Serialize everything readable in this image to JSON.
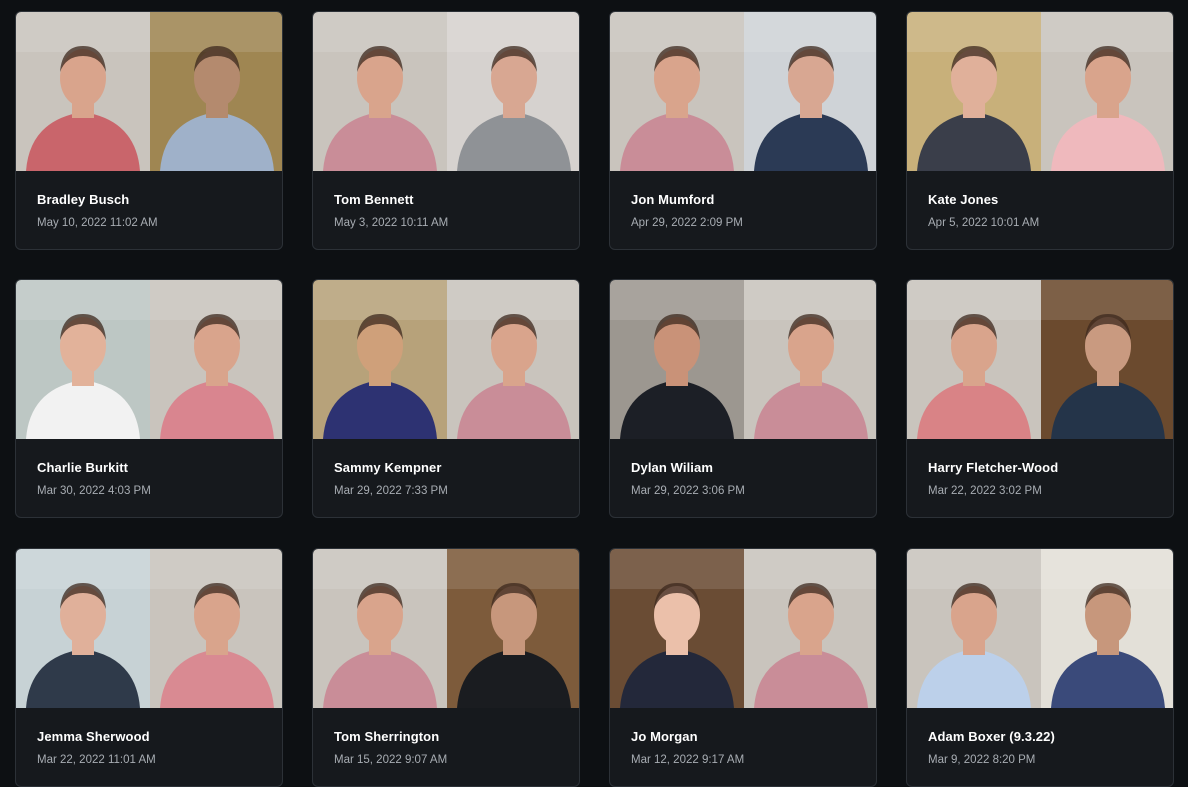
{
  "recordings": [
    {
      "name": "Bradley Busch",
      "date": "May 10, 2022 11:02 AM",
      "left_bg": "#c9c4bd",
      "left_shirt": "#c9656b",
      "left_skin": "#d9a48c",
      "right_bg": "#9f8652",
      "right_shirt": "#9fb1c9",
      "right_skin": "#b48a6e"
    },
    {
      "name": "Tom Bennett",
      "date": "May 3, 2022 10:11 AM",
      "left_bg": "#c9c4bd",
      "left_shirt": "#c98d98",
      "left_skin": "#d9a48c",
      "right_bg": "#d6d2cf",
      "right_shirt": "#8f9296",
      "right_skin": "#d8a792"
    },
    {
      "name": "Jon Mumford",
      "date": "Apr 29, 2022 2:09 PM",
      "left_bg": "#c9c4bd",
      "left_shirt": "#c98d98",
      "left_skin": "#d9a48c",
      "right_bg": "#cfd3d7",
      "right_shirt": "#2b3a55",
      "right_skin": "#d8a792"
    },
    {
      "name": "Kate Jones",
      "date": "Apr 5, 2022 10:01 AM",
      "left_bg": "#c8b07a",
      "left_shirt": "#3a3e4a",
      "left_skin": "#e0b09a",
      "right_bg": "#c9c4bd",
      "right_shirt": "#efb9bd",
      "right_skin": "#d9a48c"
    },
    {
      "name": "Charlie Burkitt",
      "date": "Mar 30, 2022 4:03 PM",
      "left_bg": "#bdc7c4",
      "left_shirt": "#f2f2f2",
      "left_skin": "#e2b29a",
      "right_bg": "#c9c4bd",
      "right_shirt": "#d9858f",
      "right_skin": "#d9a48c"
    },
    {
      "name": "Sammy Kempner",
      "date": "Mar 29, 2022 7:33 PM",
      "left_bg": "#b7a27a",
      "left_shirt": "#2d3272",
      "left_skin": "#cfa07a",
      "right_bg": "#c9c4bd",
      "right_shirt": "#c98d98",
      "right_skin": "#d9a48c"
    },
    {
      "name": "Dylan Wiliam",
      "date": "Mar 29, 2022 3:06 PM",
      "left_bg": "#9c9790",
      "left_shirt": "#1c1f26",
      "left_skin": "#c99278",
      "right_bg": "#c9c4bd",
      "right_shirt": "#c98d98",
      "right_skin": "#d9a48c"
    },
    {
      "name": "Harry Fletcher-Wood",
      "date": "Mar 22, 2022 3:02 PM",
      "left_bg": "#c9c4bd",
      "left_shirt": "#d98386",
      "left_skin": "#d9a48c",
      "right_bg": "#6b4a2e",
      "right_shirt": "#243449",
      "right_skin": "#c99a80"
    },
    {
      "name": "Jemma Sherwood",
      "date": "Mar 22, 2022 11:01 AM",
      "left_bg": "#c7d2d5",
      "left_shirt": "#2f3a4a",
      "left_skin": "#e0b09a",
      "right_bg": "#c9c4bd",
      "right_shirt": "#d98a92",
      "right_skin": "#d9a48c"
    },
    {
      "name": "Tom Sherrington",
      "date": "Mar 15, 2022 9:07 AM",
      "left_bg": "#c9c4bd",
      "left_shirt": "#c98d98",
      "left_skin": "#d9a48c",
      "right_bg": "#7d5b3b",
      "right_shirt": "#1a1c20",
      "right_skin": "#c7977c"
    },
    {
      "name": "Jo Morgan",
      "date": "Mar 12, 2022 9:17 AM",
      "left_bg": "#6a4c34",
      "left_shirt": "#23283a",
      "left_skin": "#ebc0aa",
      "right_bg": "#c9c4bd",
      "right_shirt": "#c98d98",
      "right_skin": "#d9a48c"
    },
    {
      "name": "Adam Boxer (9.3.22)",
      "date": "Mar 9, 2022 8:20 PM",
      "left_bg": "#c9c4bd",
      "left_shirt": "#bcd0ea",
      "left_skin": "#d9a48c",
      "right_bg": "#e3e0d8",
      "right_shirt": "#3a4a7a",
      "right_skin": "#c7977c"
    }
  ]
}
